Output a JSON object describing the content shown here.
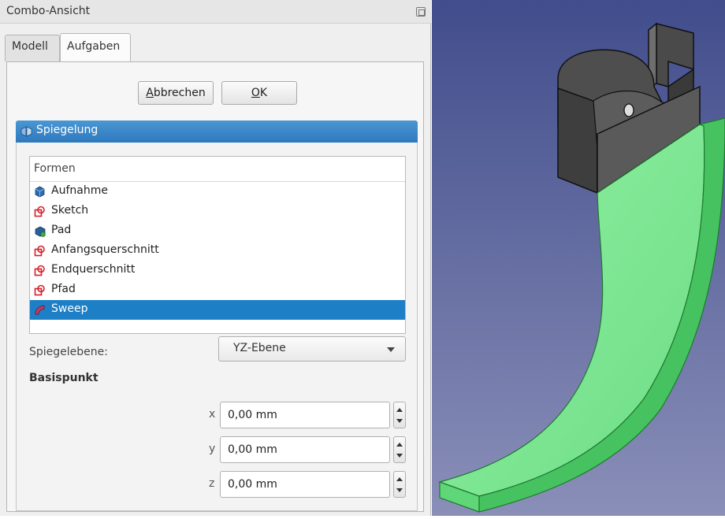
{
  "window": {
    "title": "Combo-Ansicht",
    "float_icon": "float-window-icon"
  },
  "tabs": [
    {
      "label": "Modell",
      "active": false
    },
    {
      "label": "Aufgaben",
      "active": true
    }
  ],
  "buttons": {
    "cancel": "Abbrechen",
    "ok": "OK"
  },
  "section": {
    "title": "Spiegelung",
    "icon": "mirror-feature-icon"
  },
  "shapes": {
    "header": "Formen",
    "items": [
      {
        "label": "Aufnahme",
        "icon": "body-icon"
      },
      {
        "label": "Sketch",
        "icon": "sketch-icon"
      },
      {
        "label": "Pad",
        "icon": "pad-icon"
      },
      {
        "label": "Anfangsquerschnitt",
        "icon": "sketch-icon"
      },
      {
        "label": "Endquerschnitt",
        "icon": "sketch-icon"
      },
      {
        "label": "Pfad",
        "icon": "sketch-icon"
      },
      {
        "label": "Sweep",
        "icon": "sweep-icon",
        "selected": true
      }
    ]
  },
  "mirror_plane": {
    "label": "Spiegelebene:",
    "value": "YZ-Ebene"
  },
  "base_point": {
    "label": "Basispunkt",
    "x": {
      "label": "x",
      "value": "0,00 mm"
    },
    "y": {
      "label": "y",
      "value": "0,00 mm"
    },
    "z": {
      "label": "z",
      "value": "0,00 mm"
    }
  },
  "colors": {
    "selection": "#1d7fc6",
    "section_header": "#3a86c8",
    "viewport_top": "#414d8c",
    "viewport_bottom": "#8a8fb8",
    "sweep_face": "#86e89a",
    "block_face": "#5f5f5f"
  }
}
